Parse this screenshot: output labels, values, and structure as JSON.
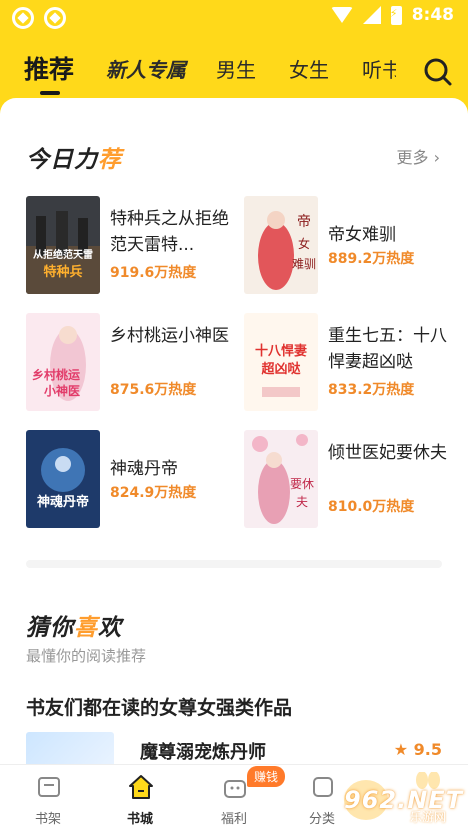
{
  "status_bar": {
    "time": "8:48"
  },
  "top_nav": {
    "tabs": [
      {
        "label": "推荐"
      },
      {
        "label": "新人专属"
      },
      {
        "label": "男生"
      },
      {
        "label": "女生"
      },
      {
        "label": "听书"
      }
    ],
    "search_icon": "search-icon"
  },
  "today_section": {
    "title_main": "今日力",
    "title_highlight": "荐",
    "more_label": "更多",
    "books": [
      {
        "title": "特种兵之从拒绝范天雷特...",
        "heat": "919.6万热度",
        "cover_text": "从拒绝范天雷 特种兵之"
      },
      {
        "title": "帝女难驯",
        "heat": "889.2万热度",
        "cover_text": "帝女难驯"
      },
      {
        "title": "乡村桃运小神医",
        "heat": "875.6万热度",
        "cover_text": "乡村桃运 小神医"
      },
      {
        "title": "重生七五：十八悍妻超凶哒",
        "heat": "833.2万热度",
        "cover_text": "十八悍妻 超凶哒"
      },
      {
        "title": "神魂丹帝",
        "heat": "824.9万热度",
        "cover_text": "神魂丹帝"
      },
      {
        "title": "倾世医妃要休夫",
        "heat": "810.0万热度",
        "cover_text": "要休夫"
      }
    ]
  },
  "guess_section": {
    "title_main": "猜你",
    "title_highlight": "喜",
    "title_end": "欢",
    "subtitle": "最懂你的阅读推荐",
    "group_title": "书友们都在读的女尊女强类作品",
    "first_item": {
      "title": "魔尊溺宠炼丹师",
      "score": "9.5"
    }
  },
  "bottom_nav": {
    "items": [
      {
        "label": "书架"
      },
      {
        "label": "书城"
      },
      {
        "label": "福利"
      },
      {
        "label": "分类"
      }
    ],
    "welfare_badge": "赚钱"
  },
  "watermark": {
    "text": "962.NET",
    "sub": "乐游网"
  },
  "colors": {
    "accent": "#ffd91a",
    "heat": "#f08a2a",
    "text": "#222222"
  }
}
